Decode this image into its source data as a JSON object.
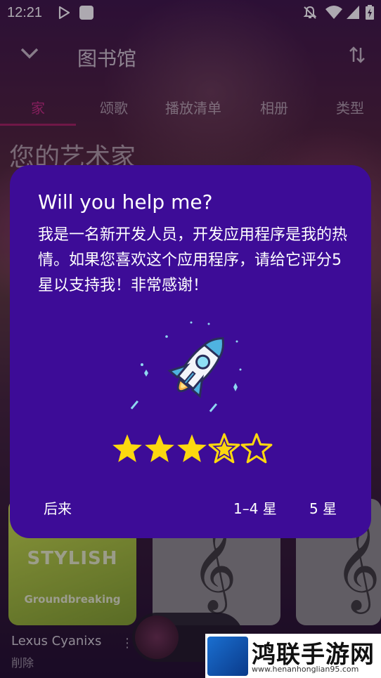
{
  "status_bar": {
    "time": "12:21"
  },
  "toolbar": {
    "title": "图书馆"
  },
  "tabs": [
    {
      "label": "家"
    },
    {
      "label": "颂歌"
    },
    {
      "label": "播放清单"
    },
    {
      "label": "相册"
    },
    {
      "label": "类型"
    }
  ],
  "section": {
    "title": "您的艺术家"
  },
  "albums": [
    {
      "line1": "STYLISH",
      "line2": "Groundbreaking"
    },
    {},
    {}
  ],
  "artist": {
    "name": "Lexus Cyanixs",
    "subtitle": "削除"
  },
  "dialog": {
    "title": "Will you help me?",
    "body": "我是一名新开发人员，开发应用程序是我的热情。如果您喜欢这个应用程序，请给它评分5星以支持我！非常感谢！",
    "rating": 3.5,
    "rating_max": 5,
    "buttons": {
      "later": "后来",
      "low": "1–4 星",
      "high": "5 星"
    }
  },
  "watermark": {
    "name": "鸿联手游网",
    "url": "www.henanhonglian95.com"
  },
  "colors": {
    "dialog_bg": "#3d0c97",
    "accent": "#c02a7e",
    "star": "#fcd80f"
  }
}
